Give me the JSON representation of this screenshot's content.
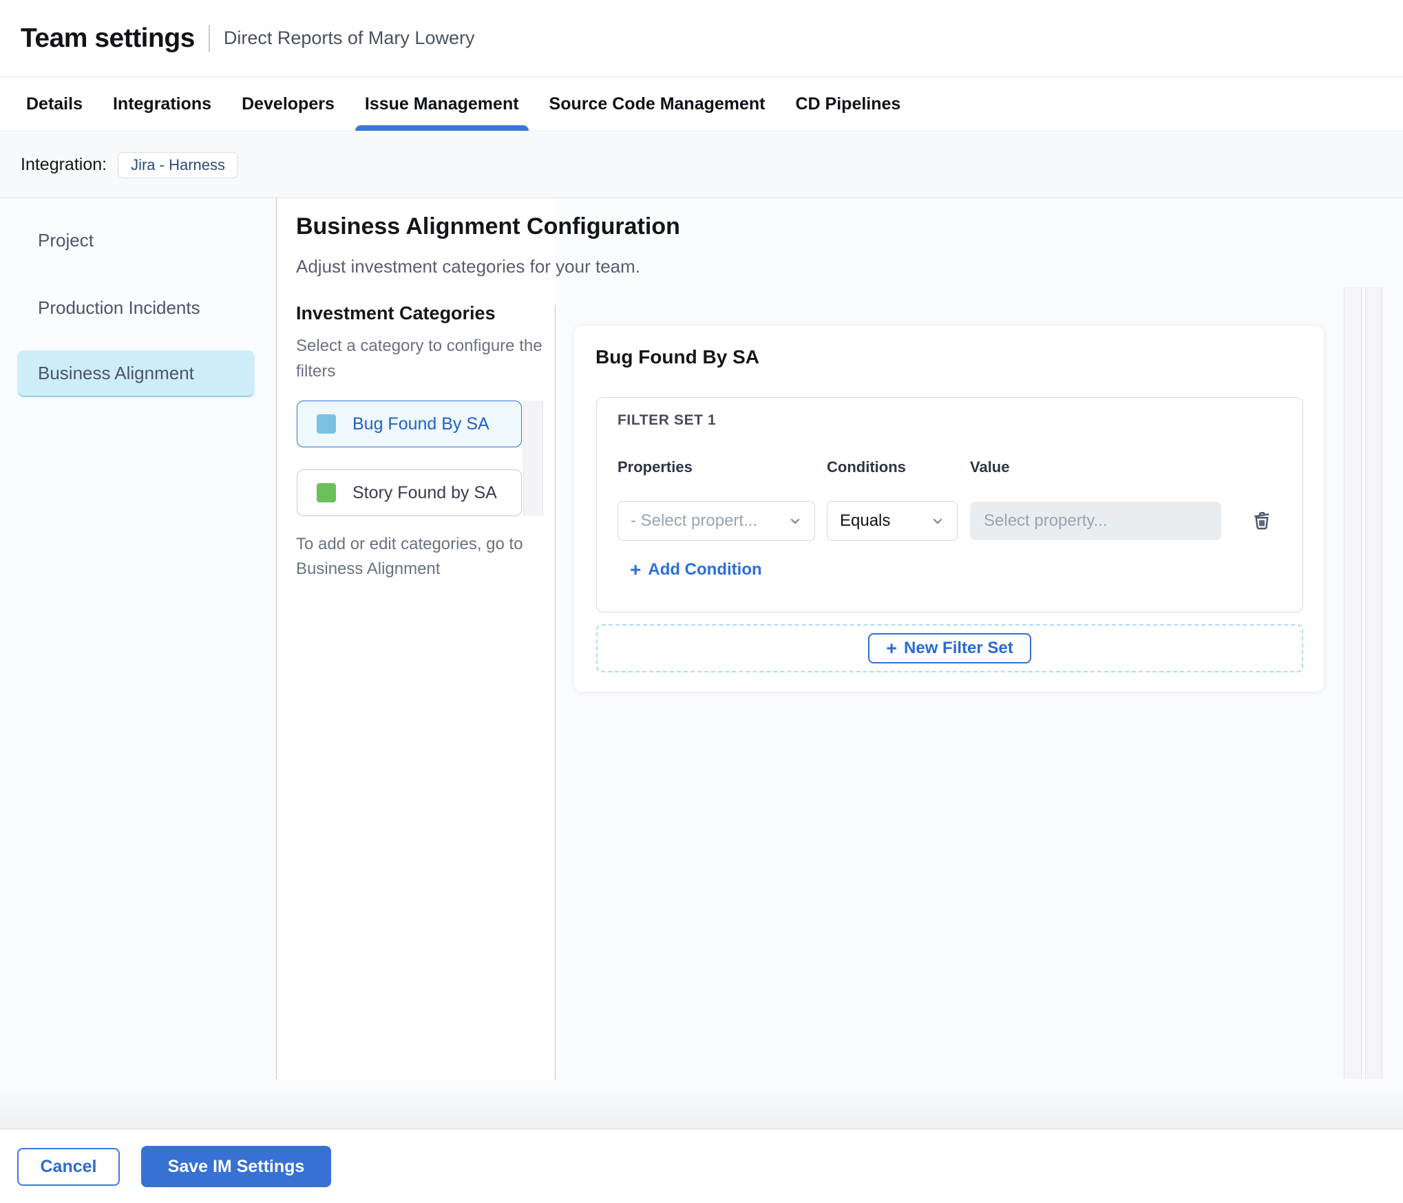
{
  "header": {
    "title": "Team settings",
    "subtitle": "Direct Reports of Mary Lowery"
  },
  "tabs": {
    "items": [
      {
        "label": "Details",
        "active": false
      },
      {
        "label": "Integrations",
        "active": false
      },
      {
        "label": "Developers",
        "active": false
      },
      {
        "label": "Issue Management",
        "active": true
      },
      {
        "label": "Source Code Management",
        "active": false
      },
      {
        "label": "CD Pipelines",
        "active": false
      }
    ]
  },
  "integration": {
    "label": "Integration:",
    "chip": "Jira - Harness"
  },
  "sidebar": {
    "items": [
      {
        "label": "Project",
        "active": false
      },
      {
        "label": "Production Incidents",
        "active": false
      },
      {
        "label": "Business Alignment",
        "active": true
      }
    ]
  },
  "main": {
    "title": "Business Alignment Configuration",
    "subtitle": "Adjust investment categories for your team.",
    "categories": {
      "title": "Investment Categories",
      "hint_lines": [
        "Select a category to configure the",
        "filters"
      ],
      "items": [
        {
          "label": "Bug Found By SA",
          "swatch_color": "#7cc0e0",
          "active": true
        },
        {
          "label": "Story Found by SA",
          "swatch_color": "#6cc05c",
          "active": false
        }
      ],
      "note_lines": [
        "To add or edit categories, go to",
        "Business Alignment"
      ]
    },
    "panel": {
      "title": "Bug Found By SA",
      "filter_set": {
        "title": "FILTER SET 1",
        "columns": {
          "properties": "Properties",
          "conditions": "Conditions",
          "value": "Value"
        },
        "property_placeholder": "- Select propert...",
        "condition_value": "Equals",
        "value_placeholder": "Select property...",
        "add_condition": "Add Condition"
      },
      "new_filter_set": "New Filter Set"
    }
  },
  "footer": {
    "cancel": "Cancel",
    "save": "Save IM Settings"
  },
  "icons": {
    "plus": "+"
  },
  "colors": {
    "primary_blue": "#3671d3",
    "tab_underline": "#3b77dd",
    "active_sidebar_bg": "#cdeef9",
    "active_category_bg": "#eef8fd",
    "active_category_border": "#2e70d2",
    "link_blue": "#2a6fd8",
    "dashed_border": "#abdcf3",
    "value_input_bg": "#e9edf0",
    "band_bg": "#f8f9fb"
  }
}
